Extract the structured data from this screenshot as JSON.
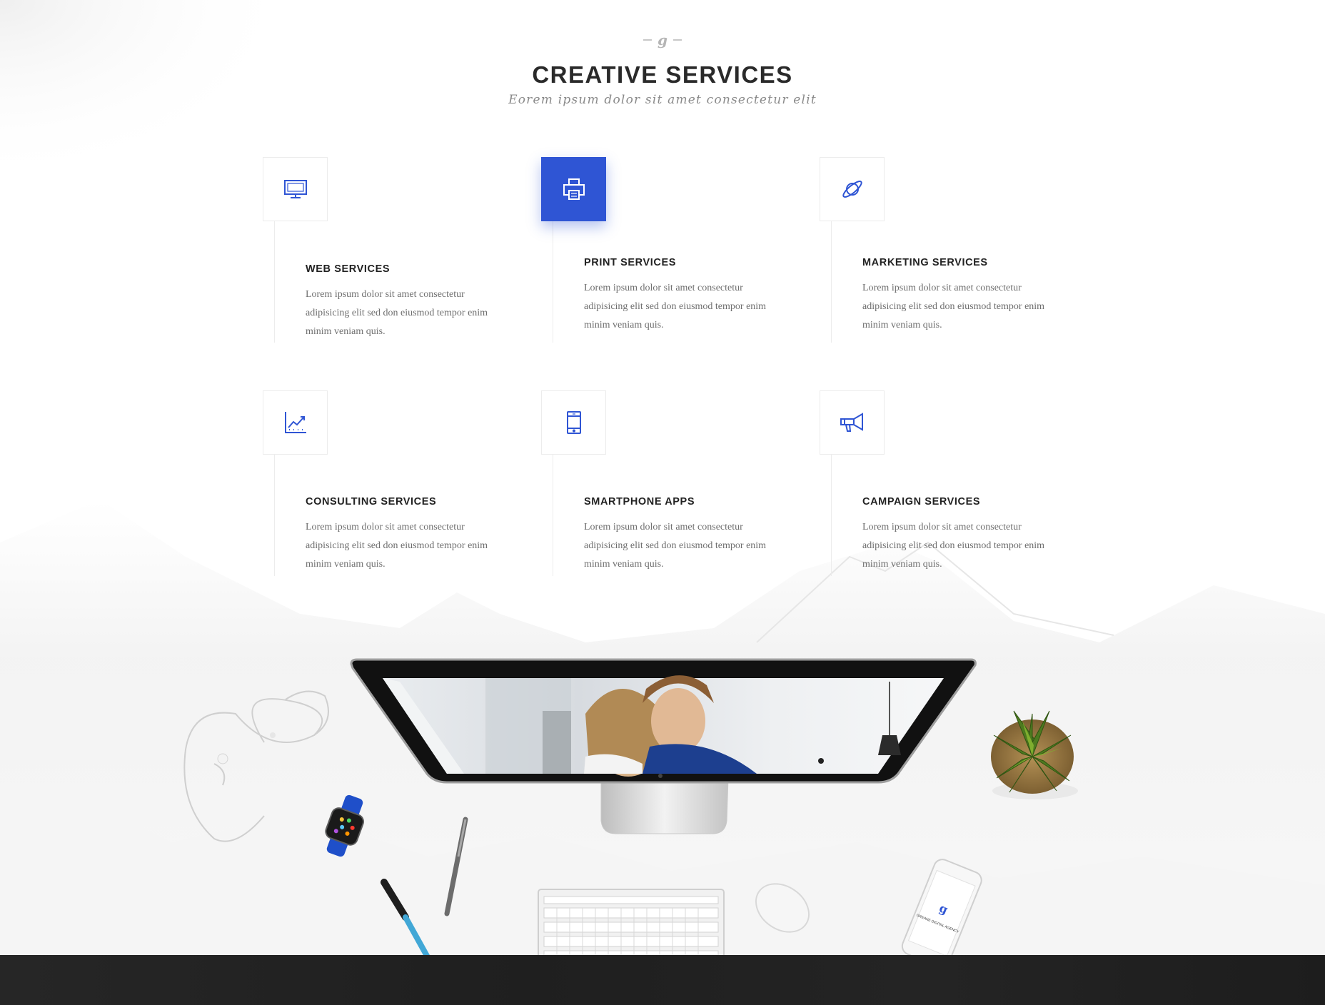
{
  "header": {
    "logo_glyph": "g",
    "title": "CREATIVE SERVICES",
    "subtitle": "Eorem ipsum dolor sit amet consectetur elit"
  },
  "accent_color": "#2f55d4",
  "services": [
    {
      "icon": "monitor-icon",
      "title": "WEB SERVICES",
      "text": "Lorem ipsum dolor sit amet consectetur adipisicing elit sed don eiusmod tempor enim minim veniam quis."
    },
    {
      "icon": "printer-icon",
      "title": "PRINT SERVICES",
      "text": "Lorem ipsum dolor sit amet consectetur adipisicing elit sed don eiusmod tempor enim minim veniam quis.",
      "active": true
    },
    {
      "icon": "planet-icon",
      "title": "MARKETING SERVICES",
      "text": "Lorem ipsum dolor sit amet consectetur adipisicing elit sed don eiusmod tempor enim minim veniam quis."
    },
    {
      "icon": "chart-icon",
      "title": "CONSULTING SERVICES",
      "text": "Lorem ipsum dolor sit amet consectetur adipisicing elit sed don eiusmod tempor enim minim veniam quis."
    },
    {
      "icon": "smartphone-icon",
      "title": "SMARTPHONE APPS",
      "text": "Lorem ipsum dolor sit amet consectetur adipisicing elit sed don eiusmod tempor enim minim veniam quis."
    },
    {
      "icon": "megaphone-icon",
      "title": "CAMPAIGN SERVICES",
      "text": "Lorem ipsum dolor sit amet consectetur adipisicing elit sed don eiusmod tempor enim minim veniam quis."
    }
  ],
  "mockup": {
    "phone_screen_text": "GREANE DIGITAL AGENCY"
  }
}
